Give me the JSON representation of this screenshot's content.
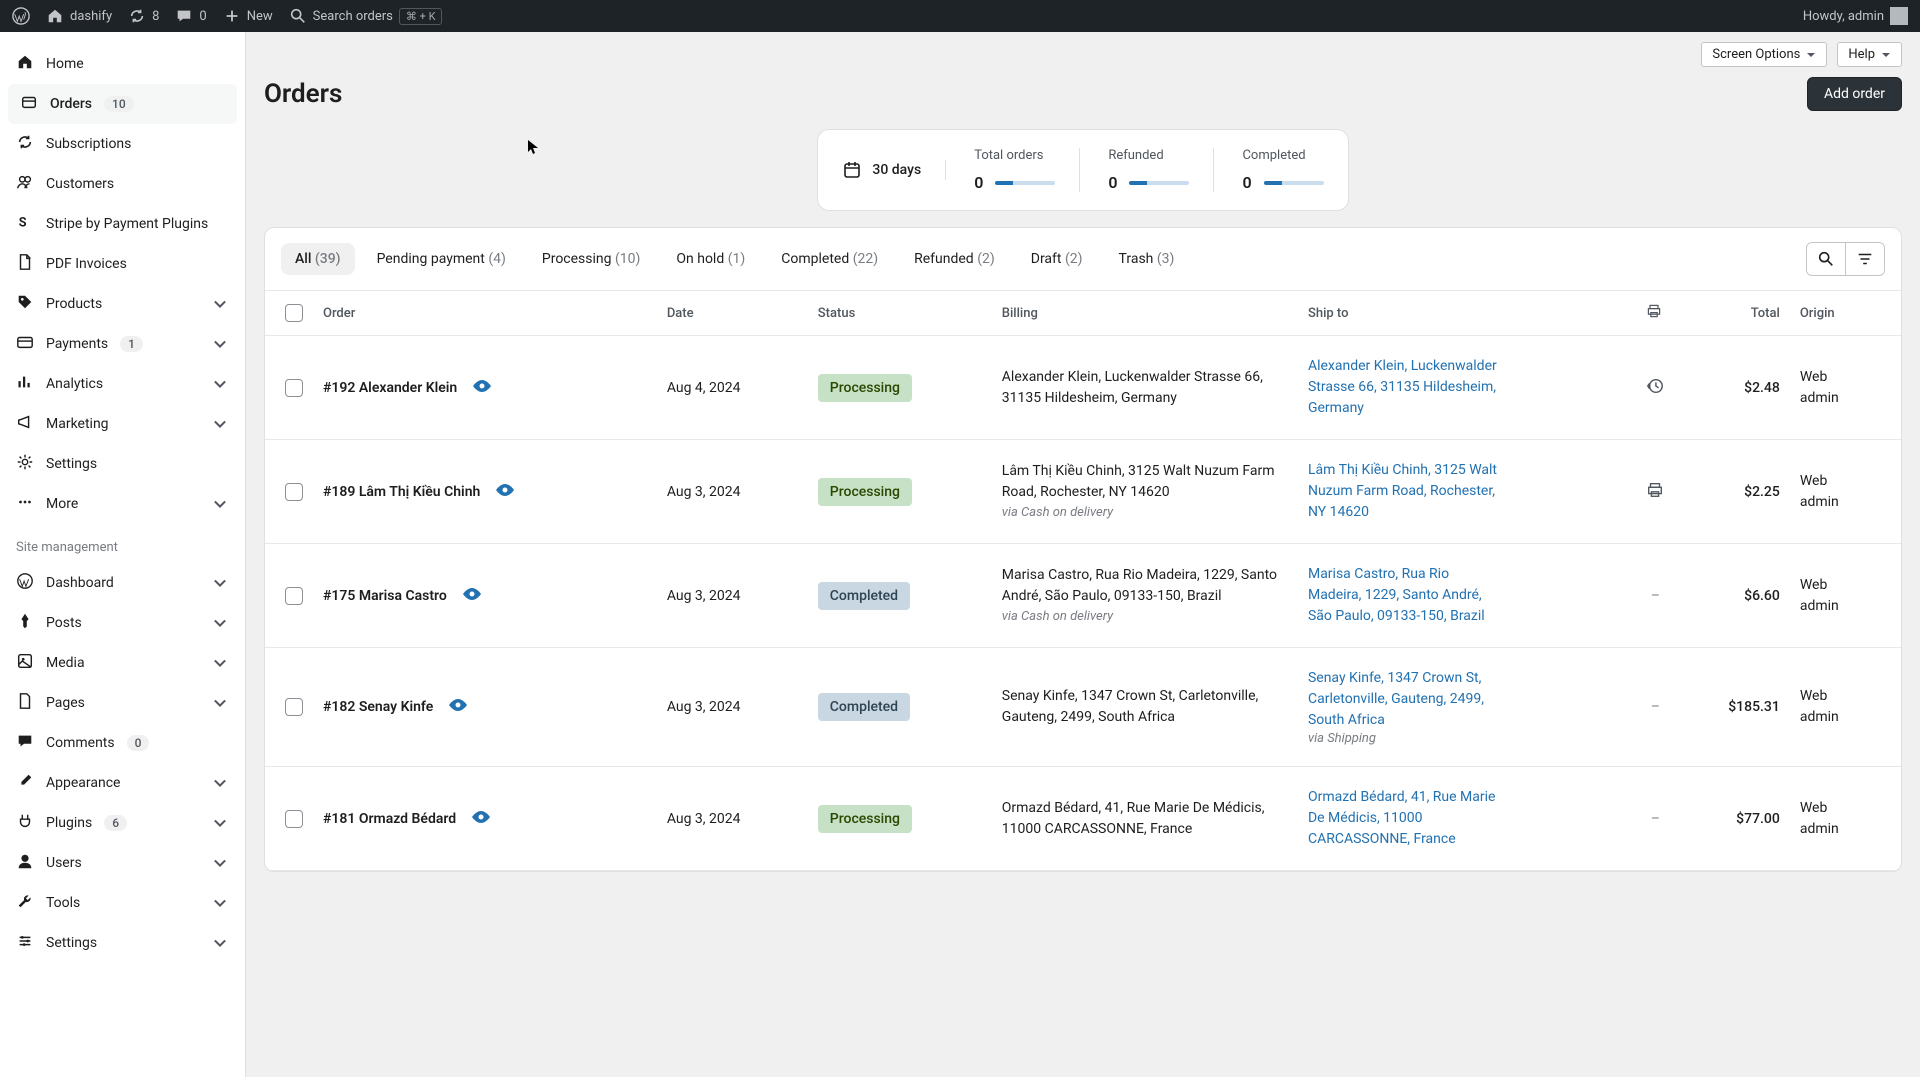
{
  "adminbar": {
    "site_name": "dashify",
    "updates_count": "8",
    "comments_count": "0",
    "new_label": "New",
    "search_placeholder": "Search orders",
    "search_shortcut": "⌘ + K",
    "howdy": "Howdy, admin"
  },
  "sidebar": {
    "main": [
      {
        "label": "Home",
        "icon": "home"
      },
      {
        "label": "Orders",
        "icon": "orders",
        "badge": "10",
        "active": true
      },
      {
        "label": "Subscriptions",
        "icon": "refresh"
      },
      {
        "label": "Customers",
        "icon": "users"
      },
      {
        "label": "Stripe by Payment Plugins",
        "icon": "stripe"
      },
      {
        "label": "PDF Invoices",
        "icon": "file"
      },
      {
        "label": "Products",
        "icon": "tag",
        "chevron": true
      },
      {
        "label": "Payments",
        "icon": "card",
        "badge": "1",
        "chevron": true
      },
      {
        "label": "Analytics",
        "icon": "bars",
        "chevron": true
      },
      {
        "label": "Marketing",
        "icon": "megaphone",
        "chevron": true
      },
      {
        "label": "Settings",
        "icon": "gear"
      },
      {
        "label": "More",
        "icon": "dots",
        "chevron": true
      }
    ],
    "section_label": "Site management",
    "mgmt": [
      {
        "label": "Dashboard",
        "icon": "wp",
        "chevron": true
      },
      {
        "label": "Posts",
        "icon": "pin",
        "chevron": true
      },
      {
        "label": "Media",
        "icon": "media",
        "chevron": true
      },
      {
        "label": "Pages",
        "icon": "page",
        "chevron": true
      },
      {
        "label": "Comments",
        "icon": "comment",
        "badge": "0"
      },
      {
        "label": "Appearance",
        "icon": "brush",
        "chevron": true
      },
      {
        "label": "Plugins",
        "icon": "plug",
        "badge": "6",
        "chevron": true
      },
      {
        "label": "Users",
        "icon": "user",
        "chevron": true
      },
      {
        "label": "Tools",
        "icon": "wrench",
        "chevron": true
      },
      {
        "label": "Settings",
        "icon": "sliders",
        "chevron": true
      }
    ]
  },
  "top_buttons": {
    "screen_options": "Screen Options",
    "help": "Help"
  },
  "page": {
    "title": "Orders",
    "add_button": "Add order"
  },
  "summary": {
    "period": "30 days",
    "stats": [
      {
        "label": "Total orders",
        "value": "0"
      },
      {
        "label": "Refunded",
        "value": "0"
      },
      {
        "label": "Completed",
        "value": "0"
      }
    ]
  },
  "tabs": [
    {
      "label": "All",
      "count": "(39)",
      "active": true
    },
    {
      "label": "Pending payment",
      "count": "(4)"
    },
    {
      "label": "Processing",
      "count": "(10)"
    },
    {
      "label": "On hold",
      "count": "(1)"
    },
    {
      "label": "Completed",
      "count": "(22)"
    },
    {
      "label": "Refunded",
      "count": "(2)"
    },
    {
      "label": "Draft",
      "count": "(2)"
    },
    {
      "label": "Trash",
      "count": "(3)"
    }
  ],
  "columns": {
    "order": "Order",
    "date": "Date",
    "status": "Status",
    "billing": "Billing",
    "shipto": "Ship to",
    "total": "Total",
    "origin": "Origin"
  },
  "rows": [
    {
      "order": "#192 Alexander Klein",
      "date": "Aug 4, 2024",
      "status": "Processing",
      "status_class": "status-processing",
      "billing": "Alexander Klein, Luckenwalder Strasse 66, 31135 Hildesheim, Germany",
      "billing_via": "",
      "shipto": "Alexander Klein, Luckenwalder Strasse 66, 31135 Hildesheim, Germany",
      "shipto_via": "",
      "icon": "history",
      "total": "$2.48",
      "origin": "Web admin"
    },
    {
      "order": "#189 Lâm Thị Kiều Chinh",
      "date": "Aug 3, 2024",
      "status": "Processing",
      "status_class": "status-processing",
      "billing": "Lâm Thị Kiều Chinh, 3125 Walt Nuzum Farm Road, Rochester, NY 14620",
      "billing_via": "via Cash on delivery",
      "shipto": "Lâm Thị Kiều Chinh, 3125 Walt Nuzum Farm Road, Rochester, NY 14620",
      "shipto_via": "",
      "icon": "print",
      "total": "$2.25",
      "origin": "Web admin"
    },
    {
      "order": "#175 Marisa Castro",
      "date": "Aug 3, 2024",
      "status": "Completed",
      "status_class": "status-completed",
      "billing": "Marisa Castro, Rua Rio Madeira, 1229, Santo André, São Paulo, 09133-150, Brazil",
      "billing_via": "via Cash on delivery",
      "shipto": "Marisa Castro, Rua Rio Madeira, 1229, Santo André, São Paulo, 09133-150, Brazil",
      "shipto_via": "",
      "icon": "dash",
      "total": "$6.60",
      "origin": "Web admin"
    },
    {
      "order": "#182 Senay Kinfe",
      "date": "Aug 3, 2024",
      "status": "Completed",
      "status_class": "status-completed",
      "billing": "Senay Kinfe, 1347 Crown St, Carletonville, Gauteng, 2499, South Africa",
      "billing_via": "",
      "shipto": "Senay Kinfe, 1347 Crown St, Carletonville, Gauteng, 2499, South Africa",
      "shipto_via": "via Shipping",
      "icon": "dash",
      "total": "$185.31",
      "origin": "Web admin"
    },
    {
      "order": "#181 Ormazd Bédard",
      "date": "Aug 3, 2024",
      "status": "Processing",
      "status_class": "status-processing",
      "billing": "Ormazd Bédard, 41, Rue Marie De Médicis, 11000 CARCASSONNE, France",
      "billing_via": "",
      "shipto": "Ormazd Bédard, 41, Rue Marie De Médicis, 11000 CARCASSONNE, France",
      "shipto_via": "",
      "icon": "dash",
      "total": "$77.00",
      "origin": "Web admin"
    }
  ]
}
